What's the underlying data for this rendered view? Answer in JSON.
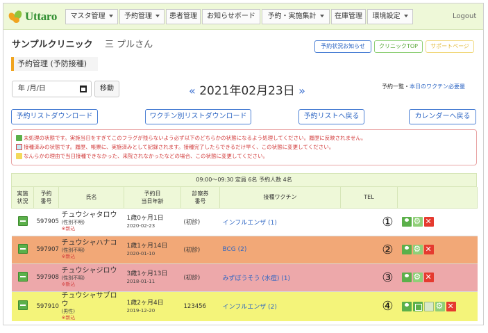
{
  "nav": {
    "logo": "Uttaro",
    "items": [
      "マスタ管理",
      "予約管理",
      "患者管理",
      "お知らせボード",
      "予約・実施集計",
      "在庫管理",
      "環境設定"
    ],
    "logout": "Logout"
  },
  "header": {
    "clinic": "サンプルクリニック",
    "user": "三 プルさん",
    "btn_notice": "予約状況お知らせ",
    "btn_top": "クリニックTOP",
    "btn_support": "サポートページ",
    "section_title": "予約管理 (予防接種)"
  },
  "date_bar": {
    "date_placeholder": "年 /月/日",
    "move_label": "移動",
    "prev": "«",
    "date": "2021年02月23日",
    "next": "»",
    "schedule_prefix": "予約一覧・",
    "schedule_link": "本日のワクチン必要量"
  },
  "actions": {
    "download_list": "予約リストダウンロード",
    "download_by_vaccine": "ワクチン別リストダウンロード",
    "back_to_list": "予約リストへ戻る",
    "back_to_calendar": "カレンダーへ戻る"
  },
  "legend": [
    "未処理の状態です。実施当日をすぎてこのフラグが残らないよう必ず以下のどちらかの状態になるよう処理してください。履歴に反映されません。",
    "接種済みの状態です。履歴、帳票に、実施済みとして記録されます。接種完了したらできるだけ早く、この状態に変更してください。",
    "なんらかの理由で当日接種できなかった、来院されなかったなどの場合、この状態に変更してください。"
  ],
  "table": {
    "slot_header": "09:00〜09:30 定員 6名 予約人数 4名",
    "columns": {
      "status_a": "実施",
      "status_b": "状況",
      "id_a": "予約",
      "id_b": "番号",
      "name": "氏名",
      "date_a": "予約日",
      "date_b": "当日年齢",
      "card_a": "診察券",
      "card_b": "番号",
      "vaccine": "接種ワクチン",
      "tel": "TEL"
    },
    "rows": [
      {
        "id": "597905",
        "name": "チュウシャタロウ",
        "gender": "(性別不明)",
        "flag": "※新込",
        "age": "1歳0ヶ月1日",
        "dob": "2020-02-23",
        "card": "(初診)",
        "vaccine": "インフルエンザ (1)",
        "no": "①",
        "color": "white"
      },
      {
        "id": "597907",
        "name": "チュウシャハナコ",
        "gender": "(性別不明)",
        "flag": "※新込",
        "age": "1歳1ヶ月14日",
        "dob": "2020-01-10",
        "card": "(初診)",
        "vaccine": "BCG (2)",
        "no": "②",
        "color": "orange"
      },
      {
        "id": "597908",
        "name": "チュウシャジロウ",
        "gender": "(性別不明)",
        "flag": "※新込",
        "age": "3歳1ヶ月13日",
        "dob": "2018-01-11",
        "card": "(初診)",
        "vaccine": "みずぼうそう (水痘) (1)",
        "no": "③",
        "color": "pink"
      },
      {
        "id": "597910",
        "name": "チュウシャサブロウ",
        "gender": "(男性)",
        "flag": "※新込",
        "age": "1歳2ヶ月4日",
        "dob": "2019-12-20",
        "card": "123456",
        "vaccine": "インフルエンザ (2)",
        "no": "④",
        "color": "yellow"
      }
    ]
  },
  "colors": {
    "nav_bg": "#eef8d8",
    "accent_blue": "#2b64c3",
    "accent_orange": "#f0a41f",
    "legend_red": "#d23b3b",
    "row_orange": "#f2a877",
    "row_pink": "#eda8aa",
    "row_yellow": "#f4f47a"
  }
}
